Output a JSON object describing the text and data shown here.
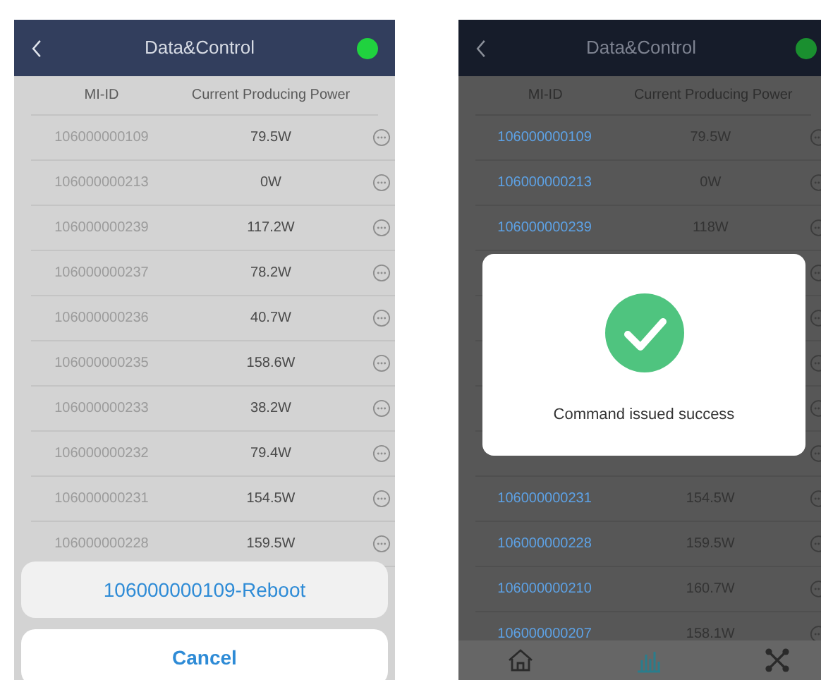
{
  "screens": [
    {
      "title": "Data&Control",
      "columns": [
        "MI-ID",
        "Current Producing Power"
      ],
      "ids_linked": false,
      "rows": [
        {
          "id": "106000000109",
          "power": "79.5W"
        },
        {
          "id": "106000000213",
          "power": "0W"
        },
        {
          "id": "106000000239",
          "power": "117.2W"
        },
        {
          "id": "106000000237",
          "power": "78.2W"
        },
        {
          "id": "106000000236",
          "power": "40.7W"
        },
        {
          "id": "106000000235",
          "power": "158.6W"
        },
        {
          "id": "106000000233",
          "power": "38.2W"
        },
        {
          "id": "106000000232",
          "power": "79.4W"
        },
        {
          "id": "106000000231",
          "power": "154.5W"
        },
        {
          "id": "106000000228",
          "power": "159.5W"
        }
      ],
      "action_sheet": {
        "action": "106000000109-Reboot",
        "cancel": "Cancel"
      }
    },
    {
      "title": "Data&Control",
      "columns": [
        "MI-ID",
        "Current Producing Power"
      ],
      "ids_linked": true,
      "rows": [
        {
          "id": "106000000109",
          "power": "79.5W"
        },
        {
          "id": "106000000213",
          "power": "0W"
        },
        {
          "id": "106000000239",
          "power": "118W"
        },
        {
          "covered": true
        },
        {
          "covered": true
        },
        {
          "covered": true
        },
        {
          "covered": true
        },
        {
          "covered": true
        },
        {
          "id": "106000000231",
          "power": "154.5W"
        },
        {
          "id": "106000000228",
          "power": "159.5W"
        },
        {
          "id": "106000000210",
          "power": "160.7W"
        },
        {
          "id": "106000000207",
          "power": "158.1W"
        }
      ],
      "dialog": {
        "message": "Command issued success"
      },
      "tab_bar": [
        {
          "kind": "home",
          "selected": false
        },
        {
          "kind": "chart",
          "selected": true
        },
        {
          "kind": "network",
          "selected": false
        }
      ]
    }
  ]
}
